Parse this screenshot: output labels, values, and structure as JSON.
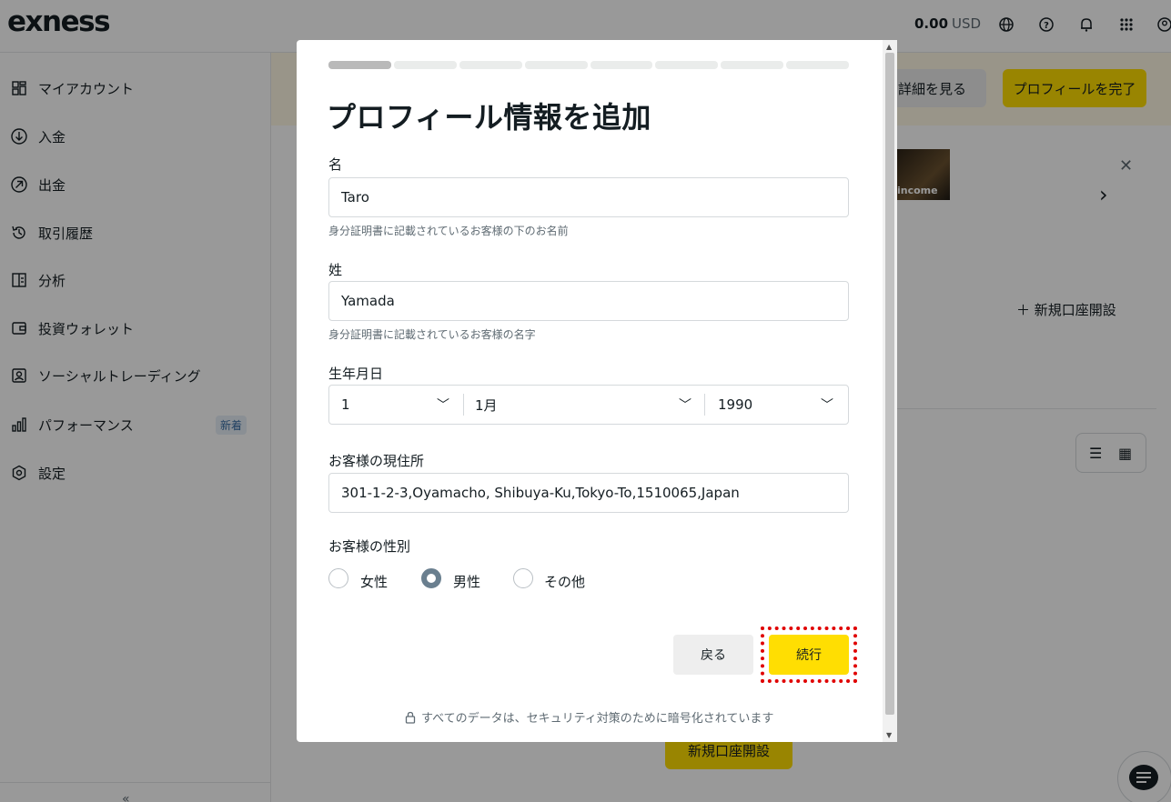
{
  "app": {
    "logo": "exness",
    "balance_amount": "0.00",
    "balance_currency": "USD"
  },
  "sidebar": {
    "items": [
      {
        "label": "マイアカウント",
        "icon": "grid-icon"
      },
      {
        "label": "入金",
        "icon": "deposit-icon"
      },
      {
        "label": "出金",
        "icon": "withdraw-icon"
      },
      {
        "label": "取引履歴",
        "icon": "history-icon"
      },
      {
        "label": "分析",
        "icon": "analytics-icon"
      },
      {
        "label": "投資ウォレット",
        "icon": "wallet-icon"
      },
      {
        "label": "ソーシャルトレーディング",
        "icon": "social-icon"
      },
      {
        "label": "パフォーマンス",
        "icon": "performance-icon",
        "badge": "新着"
      },
      {
        "label": "設定",
        "icon": "settings-icon"
      }
    ]
  },
  "banner": {
    "details_label": "詳細を見る",
    "complete_label": "プロフィールを完了"
  },
  "promo": {
    "image_text": "income"
  },
  "main": {
    "new_account_link": "新規口座開設",
    "new_account_button": "新規口座開設"
  },
  "modal": {
    "title": "プロフィール情報を追加",
    "progress": {
      "total_steps": 8,
      "current_step": 1
    },
    "first_name": {
      "label": "名",
      "value": "Taro",
      "hint": "身分証明書に記載されているお客様の下のお名前"
    },
    "last_name": {
      "label": "姓",
      "value": "Yamada",
      "hint": "身分証明書に記載されているお客様の名字"
    },
    "dob": {
      "label": "生年月日",
      "day": "1",
      "month": "1月",
      "year": "1990"
    },
    "address": {
      "label": "お客様の現住所",
      "value": "301-1-2-3,Oyamacho, Shibuya-Ku,Tokyo-To,1510065,Japan"
    },
    "gender": {
      "label": "お客様の性別",
      "options": [
        "女性",
        "男性",
        "その他"
      ],
      "selected": "男性"
    },
    "back_label": "戻る",
    "continue_label": "続行",
    "security_note": "すべてのデータは、セキュリティ対策のために暗号化されています"
  },
  "colors": {
    "accent": "#ffde02",
    "highlight": "#e00000",
    "radio_selected": "#6a7f8f"
  }
}
